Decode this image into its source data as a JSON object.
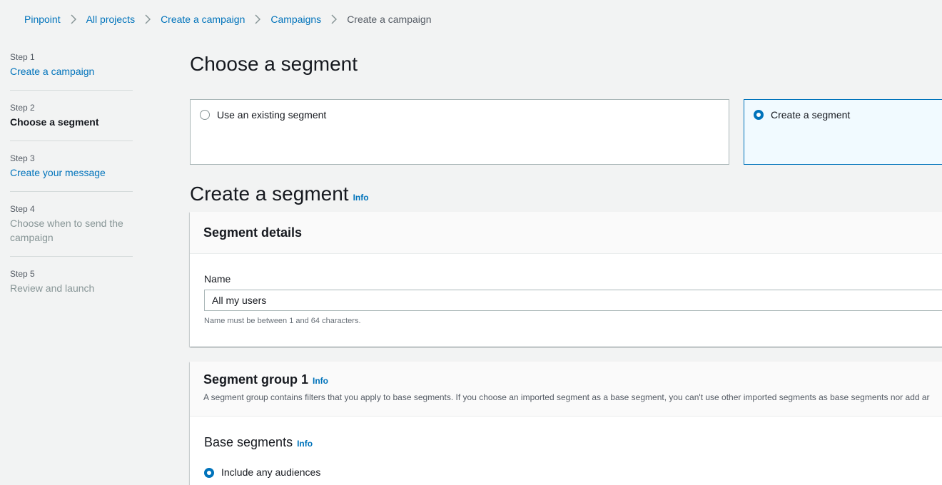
{
  "breadcrumb": {
    "items": [
      "Pinpoint",
      "All projects",
      "Create a campaign",
      "Campaigns"
    ],
    "current": "Create a campaign"
  },
  "steps": [
    {
      "number": "Step 1",
      "title": "Create a campaign",
      "state": "link"
    },
    {
      "number": "Step 2",
      "title": "Choose a segment",
      "state": "current"
    },
    {
      "number": "Step 3",
      "title": "Create your message",
      "state": "link"
    },
    {
      "number": "Step 4",
      "title": "Choose when to send the campaign",
      "state": "disabled"
    },
    {
      "number": "Step 5",
      "title": "Review and launch",
      "state": "disabled"
    }
  ],
  "page_title": "Choose a segment",
  "segment_choice": {
    "existing_label": "Use an existing segment",
    "create_label": "Create a segment",
    "selected": "create"
  },
  "create_section": {
    "title": "Create a segment",
    "info": "Info"
  },
  "segment_details": {
    "title": "Segment details",
    "name_label": "Name",
    "name_value": "All my users",
    "name_hint": "Name must be between 1 and 64 characters."
  },
  "segment_group": {
    "title": "Segment group 1",
    "info": "Info",
    "description": "A segment group contains filters that you apply to base segments. If you choose an imported segment as a base segment, you can't use other imported segments as base segments nor add ar",
    "base_segments_title": "Base segments",
    "base_info": "Info",
    "include_label": "Include any audiences",
    "include_selected": true
  },
  "colors": {
    "link": "#0073bb",
    "background": "#f2f3f3",
    "selected_tile_bg": "#f1faff"
  }
}
